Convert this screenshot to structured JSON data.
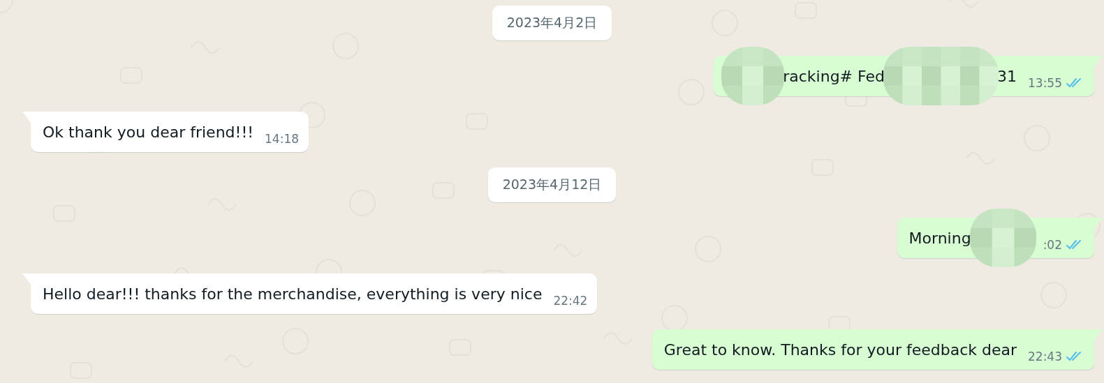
{
  "messages": [
    {
      "kind": "date",
      "text": "2023年4月2日"
    },
    {
      "kind": "outgoing",
      "segments": [
        {
          "kind": "redacted"
        },
        {
          "kind": "text",
          "text": "racking# Fed"
        },
        {
          "kind": "redacted"
        },
        {
          "kind": "text",
          "text": "31"
        }
      ],
      "time": "13:55",
      "read": true
    },
    {
      "kind": "incoming",
      "segments": [
        {
          "kind": "text",
          "text": "Ok thank you dear friend!!!"
        }
      ],
      "time": "14:18"
    },
    {
      "kind": "date",
      "text": "2023年4月12日"
    },
    {
      "kind": "outgoing",
      "segments": [
        {
          "kind": "text",
          "text": "Morning"
        },
        {
          "kind": "redacted"
        }
      ],
      "time": ":02",
      "read": true
    },
    {
      "kind": "incoming",
      "segments": [
        {
          "kind": "text",
          "text": "Hello dear!!! thanks for the merchandise, everything is very nice"
        }
      ],
      "time": "22:42"
    },
    {
      "kind": "outgoing",
      "segments": [
        {
          "kind": "text",
          "text": "Great to know. Thanks for your feedback dear"
        }
      ],
      "time": "22:43",
      "read": true
    }
  ]
}
